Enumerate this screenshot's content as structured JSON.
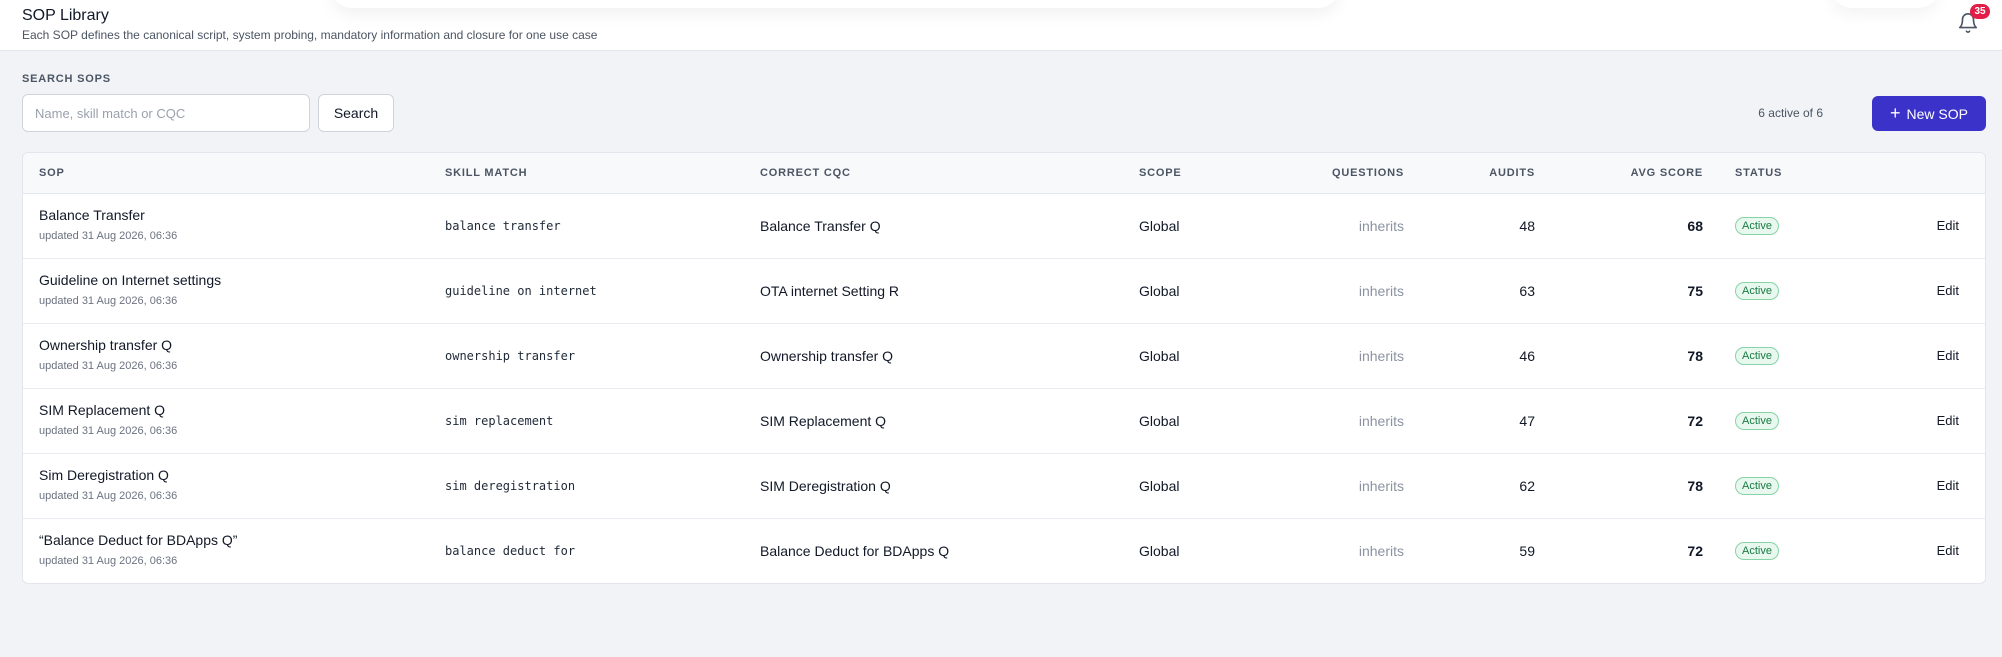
{
  "header": {
    "title": "SOP Library",
    "subtitle": "Each SOP defines the canonical script, system probing, mandatory information and closure for one use case",
    "notifications": {
      "icon": "bell-icon",
      "count": "35"
    }
  },
  "search": {
    "label": "SEARCH SOPS",
    "placeholder": "Name, skill match or CQC",
    "value": "",
    "button_label": "Search"
  },
  "summary": {
    "active_text": "6 active of 6"
  },
  "actions": {
    "new_sop_label": "New SOP",
    "new_sop_icon": "plus-icon"
  },
  "table": {
    "columns": [
      "SOP",
      "SKILL MATCH",
      "CORRECT CQC",
      "SCOPE",
      "QUESTIONS",
      "AUDITS",
      "AVG SCORE",
      "STATUS"
    ],
    "rows": [
      {
        "name": "Balance Transfer",
        "updated": "updated 31 Aug 2026, 06:36",
        "skill": "balance transfer",
        "cqc": "Balance Transfer Q",
        "scope": "Global",
        "questions": "inherits",
        "audits": "48",
        "avg_score": "68",
        "status": "Active",
        "action": "Edit"
      },
      {
        "name": "Guideline on Internet settings",
        "updated": "updated 31 Aug 2026, 06:36",
        "skill": "guideline on internet",
        "cqc": "OTA internet Setting R",
        "scope": "Global",
        "questions": "inherits",
        "audits": "63",
        "avg_score": "75",
        "status": "Active",
        "action": "Edit"
      },
      {
        "name": "Ownership transfer Q",
        "updated": "updated 31 Aug 2026, 06:36",
        "skill": "ownership transfer",
        "cqc": "Ownership transfer Q",
        "scope": "Global",
        "questions": "inherits",
        "audits": "46",
        "avg_score": "78",
        "status": "Active",
        "action": "Edit"
      },
      {
        "name": "SIM Replacement Q",
        "updated": "updated 31 Aug 2026, 06:36",
        "skill": "sim replacement",
        "cqc": "SIM Replacement Q",
        "scope": "Global",
        "questions": "inherits",
        "audits": "47",
        "avg_score": "72",
        "status": "Active",
        "action": "Edit"
      },
      {
        "name": "Sim Deregistration Q",
        "updated": "updated 31 Aug 2026, 06:36",
        "skill": "sim deregistration",
        "cqc": "SIM Deregistration Q",
        "scope": "Global",
        "questions": "inherits",
        "audits": "62",
        "avg_score": "78",
        "status": "Active",
        "action": "Edit"
      },
      {
        "name": "“Balance Deduct for BDApps Q”",
        "updated": "updated 31 Aug 2026, 06:36",
        "skill": "balance deduct for",
        "cqc": "Balance Deduct for BDApps Q",
        "scope": "Global",
        "questions": "inherits",
        "audits": "59",
        "avg_score": "72",
        "status": "Active",
        "action": "Edit"
      }
    ]
  },
  "colors": {
    "primary": "#3b32c9",
    "badge": "#e11d48",
    "active_bg": "#e9f8ef",
    "active_text": "#187a43"
  }
}
